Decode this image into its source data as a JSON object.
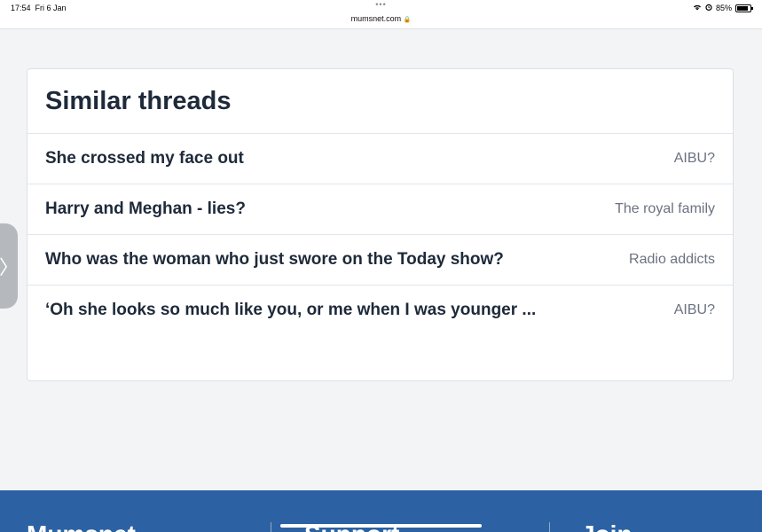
{
  "status_bar": {
    "time": "17:54",
    "date": "Fri 6 Jan",
    "dots": "•••",
    "url": "mumsnet.com",
    "battery": "85%",
    "battery_level": 0.85
  },
  "side_tab": {
    "icon": "chevron-right-icon",
    "glyph": "〉"
  },
  "similar_threads": {
    "title": "Similar threads",
    "threads": [
      {
        "title": "She crossed my face out",
        "topic": "AIBU?"
      },
      {
        "title": "Harry and Meghan - lies?",
        "topic": "The royal family"
      },
      {
        "title": "Who was the woman who just swore on the Today show?",
        "topic": "Radio addicts"
      },
      {
        "title": "‘Oh she looks so much like you, or me when I was younger ...",
        "topic": "AIBU?"
      }
    ]
  },
  "footer": {
    "items": [
      "Mumsnet",
      "Support",
      "Join"
    ]
  },
  "colors": {
    "footer_bg": "#2c62a3",
    "title_text": "#1e2a3a",
    "topic_text": "#6b7280"
  }
}
